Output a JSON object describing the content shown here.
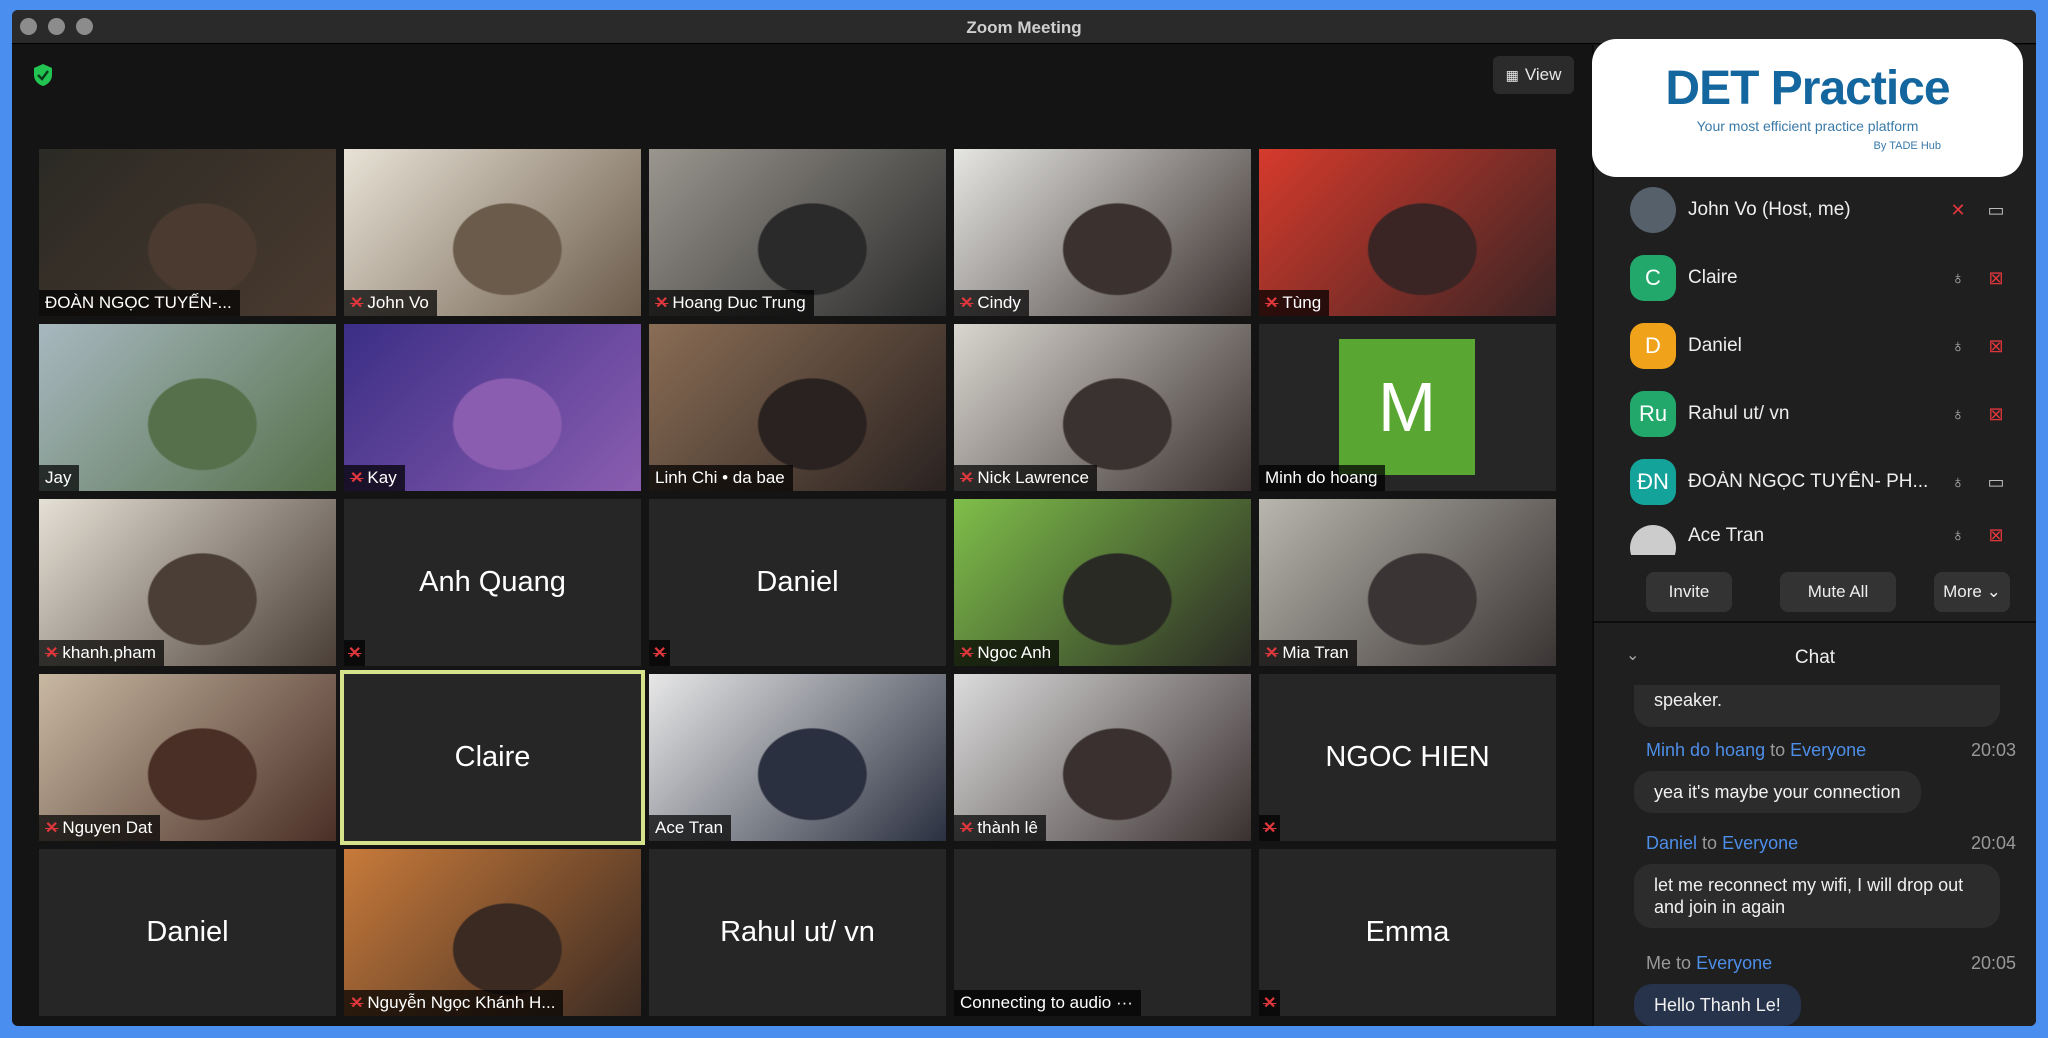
{
  "window": {
    "title": "Zoom Meeting"
  },
  "toolbar": {
    "view_label": "View",
    "security_icon": "shield-check-icon"
  },
  "logo": {
    "title": "DET Practice",
    "tagline": "Your most efficient practice platform",
    "by": "By TADE Hub"
  },
  "tiles": [
    {
      "label": "ĐOÀN NGỌC TUYẾN-...",
      "muted": false,
      "video": true,
      "c1": "#2b2a24",
      "c2": "#4a3a2f"
    },
    {
      "label": "John Vo",
      "muted": true,
      "video": true,
      "c1": "#e8e2d6",
      "c2": "#6b5b4a"
    },
    {
      "label": "Hoang Duc Trung",
      "muted": true,
      "video": true,
      "c1": "#9a968f",
      "c2": "#2a2a2a"
    },
    {
      "label": "Cindy",
      "muted": true,
      "video": true,
      "c1": "#e6e6e3",
      "c2": "#3b3230"
    },
    {
      "label": "Tùng",
      "muted": true,
      "video": true,
      "c1": "#d63a2c",
      "c2": "#3a2424"
    },
    {
      "label": "Jay",
      "muted": false,
      "video": true,
      "c1": "#a8b8c0",
      "c2": "#55704a"
    },
    {
      "label": "Kay",
      "muted": true,
      "video": true,
      "c1": "#3b2e86",
      "c2": "#8a5db0"
    },
    {
      "label": "Linh Chi • da bae",
      "muted": false,
      "video": true,
      "c1": "#8a6d55",
      "c2": "#2a2220"
    },
    {
      "label": "Nick Lawrence",
      "muted": true,
      "video": true,
      "c1": "#d9d6cf",
      "c2": "#3a3230"
    },
    {
      "label": "Minh do hoang",
      "muted": false,
      "video": false,
      "avatar": "M"
    },
    {
      "label": "khanh.pham",
      "muted": true,
      "video": true,
      "c1": "#e5e0d5",
      "c2": "#4a3e36"
    },
    {
      "label": "",
      "muted": true,
      "video": false,
      "center": "Anh Quang"
    },
    {
      "label": "",
      "muted": true,
      "video": false,
      "center": "Daniel"
    },
    {
      "label": "Ngoc Anh",
      "muted": true,
      "video": true,
      "c1": "#7fbf4a",
      "c2": "#2a2a24"
    },
    {
      "label": "Mia Tran",
      "muted": true,
      "video": true,
      "c1": "#b8b6ad",
      "c2": "#3a3434"
    },
    {
      "label": "Nguyen Dat",
      "muted": true,
      "video": true,
      "c1": "#c8b8a2",
      "c2": "#4a2f26"
    },
    {
      "label": "",
      "muted": false,
      "video": false,
      "center": "Claire",
      "active": true
    },
    {
      "label": "Ace Tran",
      "muted": false,
      "video": true,
      "c1": "#e8e8e8",
      "c2": "#2a3040"
    },
    {
      "label": "thành lê",
      "muted": true,
      "video": true,
      "c1": "#dcdcdc",
      "c2": "#3a3030"
    },
    {
      "label": "",
      "muted": true,
      "video": false,
      "center": "NGOC HIEN"
    },
    {
      "label": "",
      "muted": false,
      "video": false,
      "center": "Daniel"
    },
    {
      "label": "Nguyễn Ngọc Khánh H...",
      "muted": true,
      "video": true,
      "c1": "#c87a3a",
      "c2": "#3a2a22"
    },
    {
      "label": "",
      "muted": false,
      "video": false,
      "center": "Rahul ut/ vn"
    },
    {
      "label": "Connecting to audio ···",
      "muted": false,
      "video": false
    },
    {
      "label": "",
      "muted": true,
      "video": false,
      "center": "Emma"
    }
  ],
  "participants": [
    {
      "name": "John Vo (Host, me)",
      "initials": "",
      "color": "#55606a",
      "mic": "muted",
      "cam": "on"
    },
    {
      "name": "Claire",
      "initials": "C",
      "color": "#23a86b",
      "mic": "on",
      "cam": "off"
    },
    {
      "name": "Daniel",
      "initials": "D",
      "color": "#f0a31a",
      "mic": "on",
      "cam": "off"
    },
    {
      "name": "Rahul ut/ vn",
      "initials": "Ru",
      "color": "#23a86b",
      "mic": "on",
      "cam": "off"
    },
    {
      "name": "ĐOÀN NGỌC TUYẾN- PH...",
      "initials": "ĐN",
      "color": "#14a39a",
      "mic": "on",
      "cam": "on"
    },
    {
      "name": "Ace Tran",
      "initials": "",
      "color": "#ccc",
      "mic": "on",
      "cam": "off"
    }
  ],
  "participant_buttons": {
    "invite": "Invite",
    "mute_all": "Mute All",
    "more": "More ⌄"
  },
  "chat": {
    "title": "Chat",
    "partial": "speaker.",
    "messages": [
      {
        "from": "Minh do hoang",
        "to_word": "to",
        "to": "Everyone",
        "time": "20:03",
        "text": "yea it's maybe your connection"
      },
      {
        "from": "Daniel",
        "to_word": "to",
        "to": "Everyone",
        "time": "20:04",
        "text": "let me reconnect my wifi, I will drop out and join in again"
      },
      {
        "from": "Me",
        "to_word": "to",
        "to": "Everyone",
        "time": "20:05",
        "text": "Hello Thanh Le!"
      }
    ]
  }
}
